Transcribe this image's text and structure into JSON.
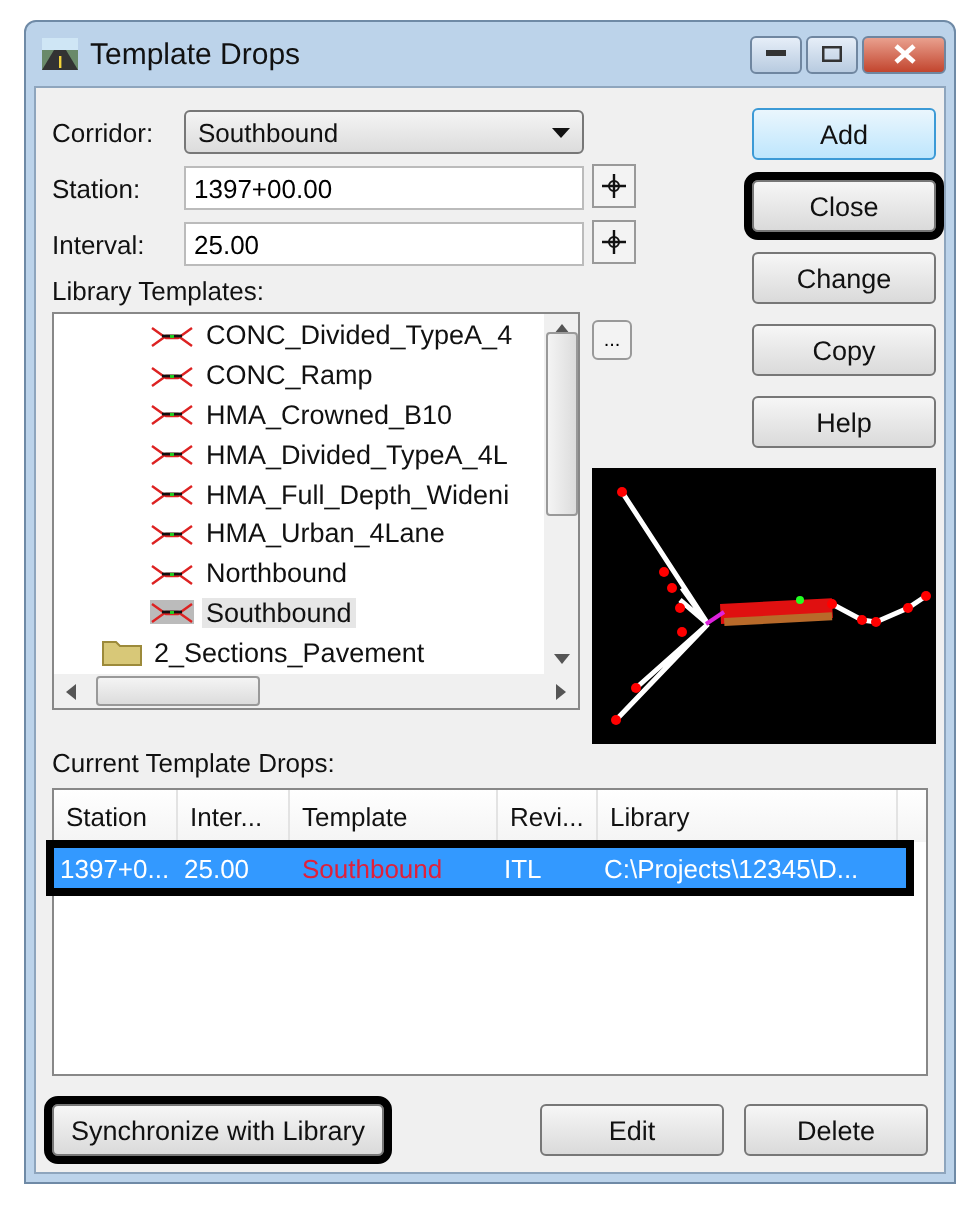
{
  "window": {
    "title": "Template Drops"
  },
  "fields": [
    {
      "label": "Corridor:",
      "kind": "dropdown",
      "value": "Southbound"
    },
    {
      "label": "Station:",
      "kind": "text",
      "value": "1397+00.00"
    },
    {
      "label": "Interval:",
      "kind": "text",
      "value": "25.00"
    }
  ],
  "side_buttons": [
    {
      "label": "Add",
      "focused": true,
      "highlighted": false
    },
    {
      "label": "Close",
      "focused": false,
      "highlighted": true
    },
    {
      "label": "Change",
      "focused": false,
      "highlighted": false
    },
    {
      "label": "Copy",
      "focused": false,
      "highlighted": false
    },
    {
      "label": "Help",
      "focused": false,
      "highlighted": false
    }
  ],
  "library": {
    "label": "Library Templates:",
    "browse": "...",
    "items": [
      {
        "label": "CONC_Divided_TypeA_4",
        "kind": "template",
        "selected": false
      },
      {
        "label": "CONC_Ramp",
        "kind": "template",
        "selected": false
      },
      {
        "label": "HMA_Crowned_B10",
        "kind": "template",
        "selected": false
      },
      {
        "label": "HMA_Divided_TypeA_4L",
        "kind": "template",
        "selected": false
      },
      {
        "label": "HMA_Full_Depth_Wideni",
        "kind": "template",
        "selected": false
      },
      {
        "label": "HMA_Urban_4Lane",
        "kind": "template",
        "selected": false
      },
      {
        "label": "Northbound",
        "kind": "template",
        "selected": false
      },
      {
        "label": "Southbound",
        "kind": "template",
        "selected": true
      },
      {
        "label": "2_Sections_Pavement",
        "kind": "folder",
        "selected": false
      }
    ]
  },
  "drops": {
    "label": "Current Template Drops:",
    "columns": [
      "Station",
      "Inter...",
      "Template",
      "Revi...",
      "Library"
    ],
    "rows": [
      {
        "cells": [
          "1397+0...",
          "25.00",
          "Southbound",
          "ITL",
          "C:\\Projects\\12345\\D..."
        ],
        "selected": true,
        "highlighted": true
      }
    ]
  },
  "bottom_buttons": [
    {
      "label": "Synchronize with Library",
      "highlighted": true
    },
    {
      "label": "Edit",
      "highlighted": false
    },
    {
      "label": "Delete",
      "highlighted": false
    }
  ]
}
